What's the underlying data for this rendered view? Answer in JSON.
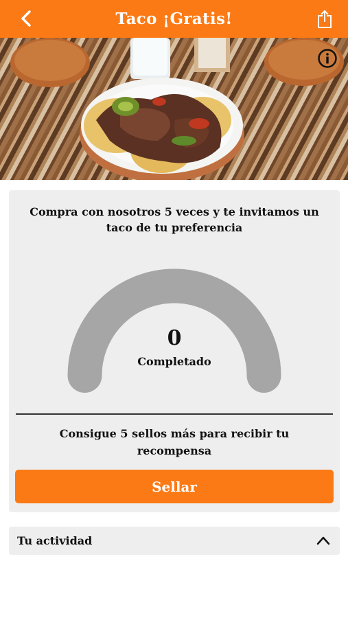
{
  "header": {
    "title": "Taco ¡Gratis!",
    "background": "#fb7a15"
  },
  "icons": {
    "back": "chevron-left-icon",
    "share": "share-icon",
    "info": "info-icon",
    "collapse": "chevron-up-icon"
  },
  "hero": {
    "image": "photo of tacos with grilled meat and guacamole on a plate"
  },
  "reward_card": {
    "promo_text": "Compra con nosotros 5 veces y te invitamos un taco de tu preferencia",
    "progress": {
      "count": "0",
      "label": "Completado",
      "stamps_done": 0,
      "stamps_total": 5,
      "track_color": "#a6a6a6"
    },
    "stamps_message": "Consigue 5 sellos más para recibir tu recompensa",
    "button_label": "Sellar"
  },
  "activity": {
    "label": "Tu actividad"
  }
}
